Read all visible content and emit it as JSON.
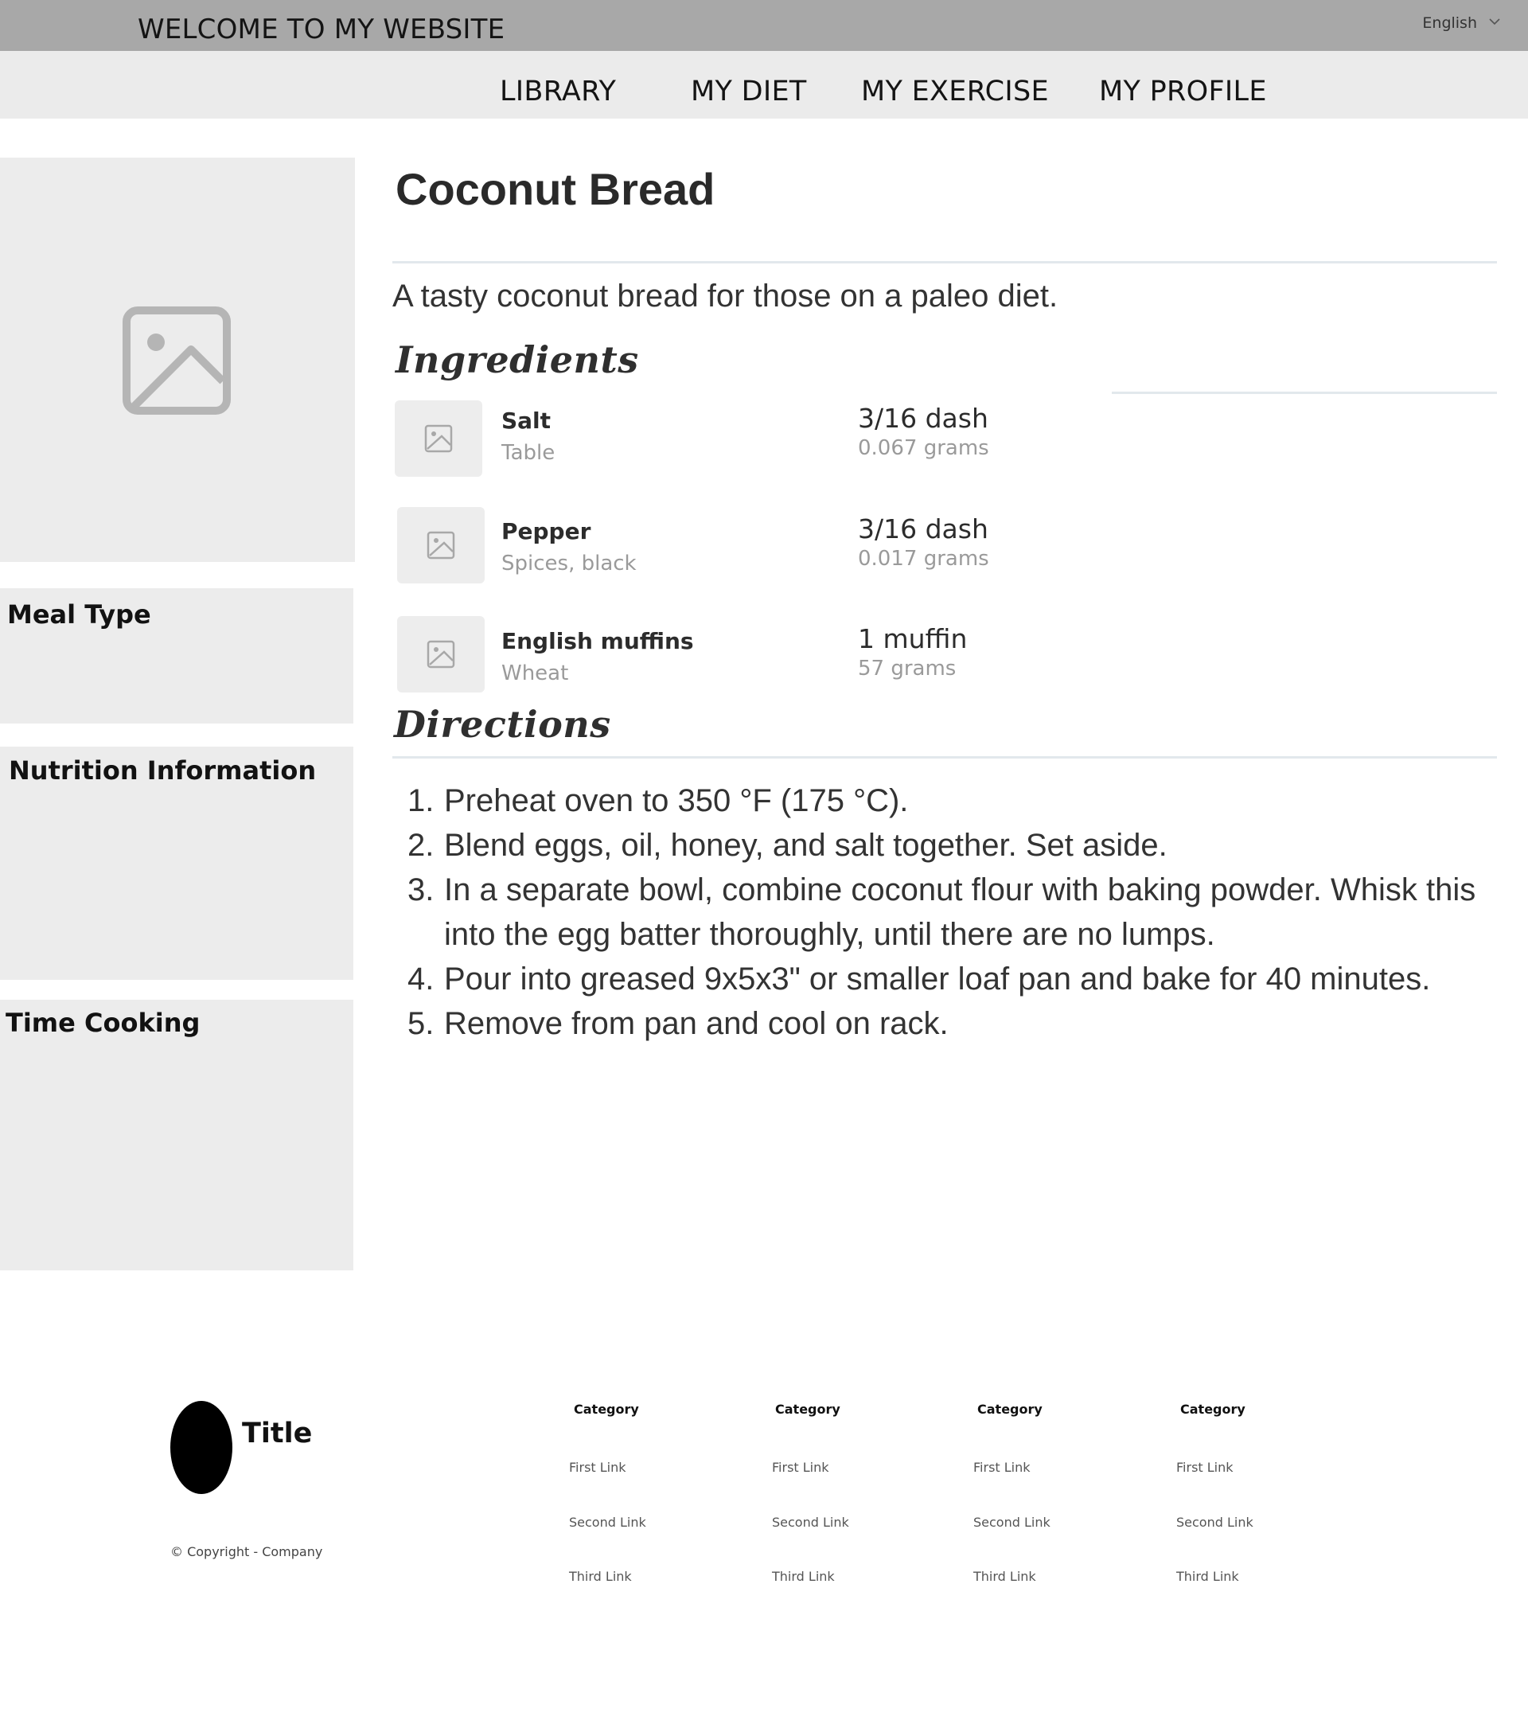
{
  "header": {
    "site_title": "WELCOME TO MY WEBSITE",
    "language": "English",
    "language_icon": "chevron-down-icon"
  },
  "nav": {
    "items": [
      {
        "label": "LIBRARY"
      },
      {
        "label": "MY DIET"
      },
      {
        "label": "MY EXERCISE"
      },
      {
        "label": "MY PROFILE"
      }
    ]
  },
  "sidebar": {
    "image_icon": "image-placeholder-icon",
    "meal_type": "Meal Type",
    "nutrition": "Nutrition Information",
    "time_cooking": "Time Cooking"
  },
  "recipe": {
    "title": "Coconut Bread",
    "description": "A tasty coconut bread for those on a paleo diet.",
    "ingredients_heading": "Ingredients",
    "directions_heading": "Directions",
    "ingredients": [
      {
        "name": "Salt",
        "sub": "Table",
        "amount": "3/16 dash",
        "grams": "0.067 grams"
      },
      {
        "name": "Pepper",
        "sub": "Spices, black",
        "amount": "3/16 dash",
        "grams": "0.017 grams"
      },
      {
        "name": "English muffins",
        "sub": "Wheat",
        "amount": "1 muffin",
        "grams": "57 grams"
      }
    ],
    "directions": [
      {
        "num": "1.",
        "text": "Preheat oven to 350 °F (175 °C)."
      },
      {
        "num": "2.",
        "text": "Blend eggs, oil, honey, and salt together. Set aside."
      },
      {
        "num": "3.",
        "text": "In a separate bowl, combine coconut flour with baking powder. Whisk this into the egg batter thoroughly, until there are no lumps."
      },
      {
        "num": "4.",
        "text": "Pour into greased 9x5x3\" or smaller loaf pan and bake for 40 minutes."
      },
      {
        "num": "5.",
        "text": "Remove from pan and cool on rack."
      }
    ]
  },
  "footer": {
    "title": "Title",
    "copyright": "© Copyright - Company",
    "columns": [
      {
        "category": "Category",
        "links": [
          "First Link",
          "Second Link",
          "Third Link"
        ]
      },
      {
        "category": "Category",
        "links": [
          "First Link",
          "Second Link",
          "Third Link"
        ]
      },
      {
        "category": "Category",
        "links": [
          "First Link",
          "Second Link",
          "Third Link"
        ]
      },
      {
        "category": "Category",
        "links": [
          "First Link",
          "Second Link",
          "Third Link"
        ]
      }
    ]
  }
}
